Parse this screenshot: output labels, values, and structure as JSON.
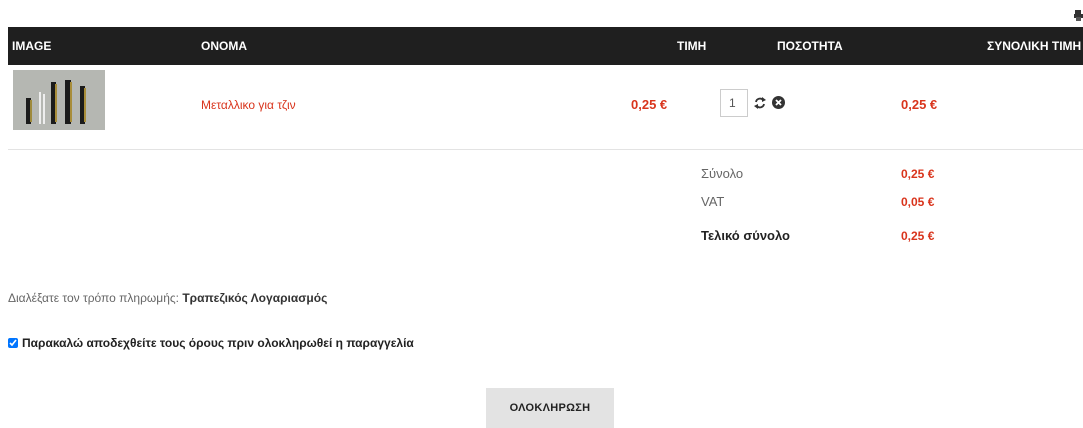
{
  "cart": {
    "headers": {
      "image": "IMAGE",
      "name": "ΟΝΟΜΑ",
      "price": "ΤΙΜΗ",
      "quantity": "ΠΟΣΟΤΗΤΑ",
      "total": "ΣΥΝΟΛΙΚΗ ΤΙΜΗ"
    },
    "items": [
      {
        "name": "Μεταλλικο για τζιν",
        "price": "0,25 €",
        "quantity": "1",
        "total": "0,25 €",
        "thumbnail_icon": "zipper-product-image"
      }
    ]
  },
  "totals": {
    "subtotal_label": "Σύνολο",
    "subtotal_value": "0,25 €",
    "vat_label": "VAT",
    "vat_value": "0,05 €",
    "grand_label": "Τελικό σύνολο",
    "grand_value": "0,25 €"
  },
  "payment": {
    "prompt": "Διαλέξατε τον τρόπο πληρωμής: ",
    "method": "Τραπεζικός Λογαριασμός"
  },
  "terms": {
    "label": "Παρακαλώ αποδεχθείτε τους όρους πριν ολοκληρωθεί η παραγγελία",
    "checked": true
  },
  "checkout": {
    "button_label": "ΟΛΟΚΛΗΡΩΣΗ"
  },
  "icons": {
    "print": "print-icon",
    "refresh": "refresh-icon",
    "remove": "remove-icon"
  },
  "colors": {
    "header_bg": "#1f1f1f",
    "price": "#d9341c",
    "button_bg": "#e3e3e3"
  }
}
